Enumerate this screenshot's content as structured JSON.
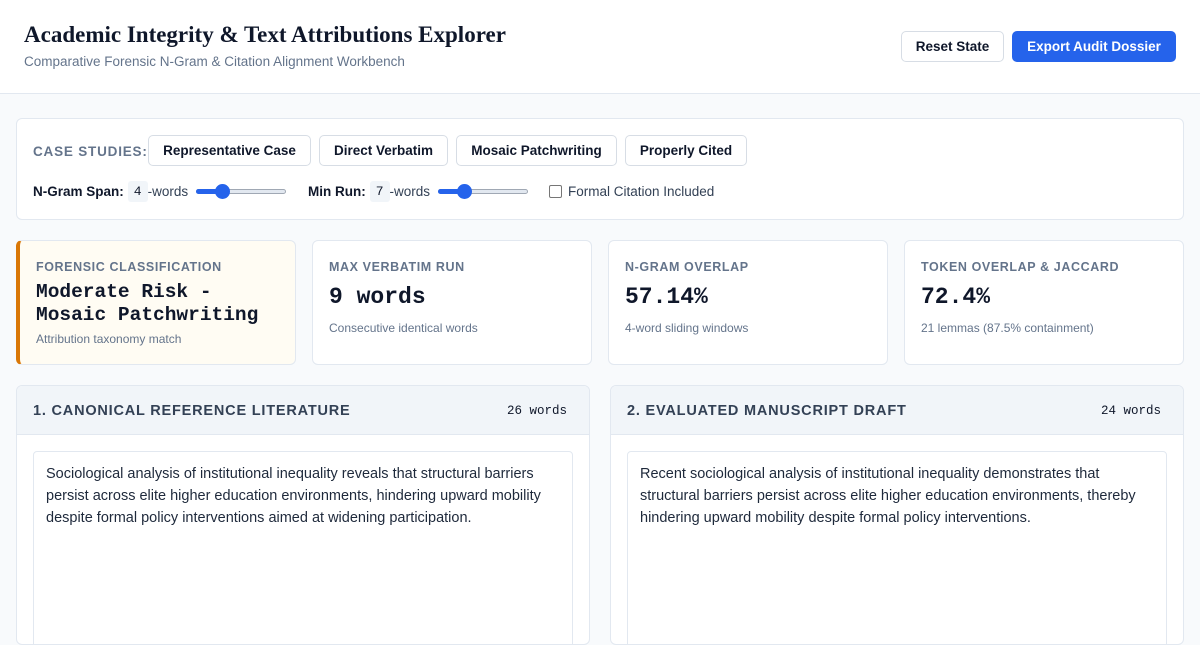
{
  "header": {
    "title": "Academic Integrity & Text Attributions Explorer",
    "subtitle": "Comparative Forensic N-Gram & Citation Alignment Workbench",
    "reset_label": "Reset State",
    "export_label": "Export Audit Dossier"
  },
  "controls": {
    "case_studies_label": "CASE STUDIES:",
    "cases": [
      "Representative Case",
      "Direct Verbatim",
      "Mosaic Patchwriting",
      "Properly Cited"
    ],
    "ngram": {
      "label": "N-Gram Span:",
      "value": "4",
      "unit": "-words",
      "fraction": 0.25
    },
    "minrun": {
      "label": "Min Run:",
      "value": "7",
      "unit": "-words",
      "fraction": 0.25
    },
    "citation_label": "Formal Citation Included"
  },
  "metrics": [
    {
      "label": "FORENSIC CLASSIFICATION",
      "value": "Moderate Risk - Mosaic Patchwriting",
      "sub": "Attribution taxonomy match"
    },
    {
      "label": "MAX VERBATIM RUN",
      "value": "9 words",
      "sub": "Consecutive identical words"
    },
    {
      "label": "N-GRAM OVERLAP",
      "value": "57.14%",
      "sub": "4-word sliding windows"
    },
    {
      "label": "TOKEN OVERLAP & JACCARD",
      "value": "72.4%",
      "sub": "21 lemmas (87.5% containment)"
    }
  ],
  "panels": {
    "reference": {
      "title": "1. CANONICAL REFERENCE LITERATURE",
      "count": "26 words",
      "text": "Sociological analysis of institutional inequality reveals that structural barriers persist across elite higher education environments, hindering upward mobility despite formal policy interventions aimed at widening participation."
    },
    "draft": {
      "title": "2. EVALUATED MANUSCRIPT DRAFT",
      "count": "24 words",
      "text": "Recent sociological analysis of institutional inequality demonstrates that structural barriers persist across elite higher education environments, thereby hindering upward mobility despite formal policy interventions."
    }
  },
  "colors": {
    "accent": "#2563eb",
    "risk": "#d97706"
  }
}
